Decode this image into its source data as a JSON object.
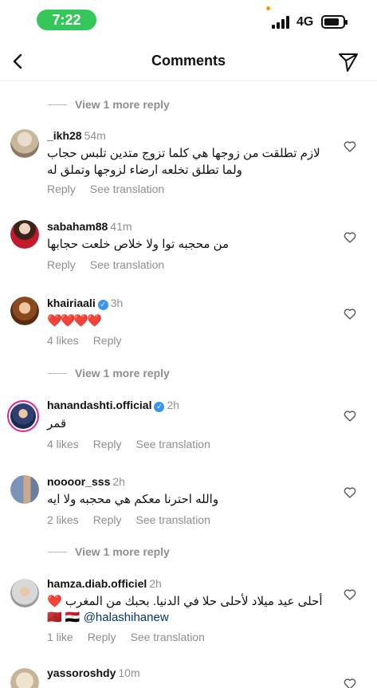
{
  "status_bar": {
    "time": "7:22",
    "network": "4G"
  },
  "header": {
    "title": "Comments"
  },
  "view_more_label": "View 1 more reply",
  "comments": [
    {
      "username": "_ikh28",
      "time": "54m",
      "verified": false,
      "text": "لازم تطلقت من زوجها هي كلما تزوج متدين تلبس حجاب ولما تطلق تخلعه ارضاء لزوجها وتملق له",
      "actions": [
        "Reply",
        "See translation"
      ]
    },
    {
      "username": "sabaham88",
      "time": "41m",
      "verified": false,
      "text": "من محجبه توا ولا خلاص خلعت حجابها",
      "actions": [
        "Reply",
        "See translation"
      ]
    },
    {
      "username": "khairiaali",
      "time": "3h",
      "verified": true,
      "text": "❤️❤️❤️❤️",
      "actions": [
        "4 likes",
        "Reply"
      ]
    },
    {
      "username": "hanandashti.official",
      "time": "2h",
      "verified": true,
      "text": "قمر",
      "actions": [
        "4 likes",
        "Reply",
        "See translation"
      ]
    },
    {
      "username": "noooor_sss",
      "time": "2h",
      "verified": false,
      "text": "والله احترنا معكم هي محجبه ولا ايه",
      "actions": [
        "2 likes",
        "Reply",
        "See translation"
      ]
    },
    {
      "username": "hamza.diab.officiel",
      "time": "2h",
      "verified": false,
      "text": "أحلى عيد ميلاد لأحلى حلا في الدنيا. بحبك من المغرب ❤️",
      "flags": "🇲🇦 🇪🇬",
      "mention": "@halashihanew",
      "actions": [
        "1 like",
        "Reply",
        "See translation"
      ]
    },
    {
      "username": "yassoroshdy",
      "time": "10m",
      "verified": false
    }
  ]
}
